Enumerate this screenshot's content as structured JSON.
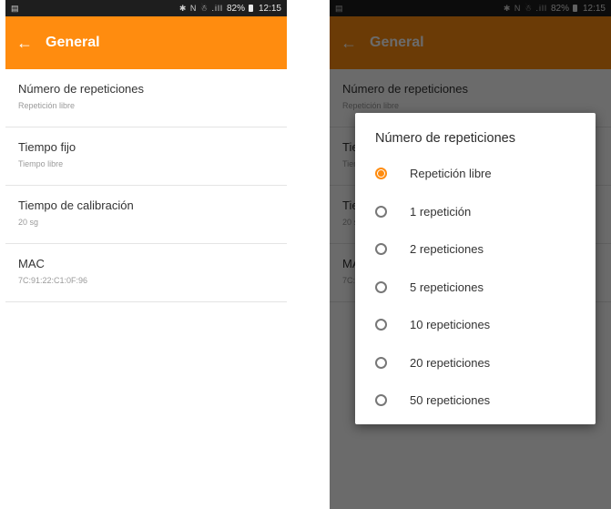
{
  "status_bar": {
    "icons": "✱ N ☃ .ill",
    "battery": "82%",
    "time": "12:15"
  },
  "toolbar": {
    "title": "General"
  },
  "settings": [
    {
      "title": "Número de repeticiones",
      "subtitle": "Repetición libre"
    },
    {
      "title": "Tiempo fijo",
      "subtitle": "Tiempo libre"
    },
    {
      "title": "Tiempo de calibración",
      "subtitle": "20 sg"
    },
    {
      "title": "MAC",
      "subtitle": "7C:91:22:C1:0F:96"
    }
  ],
  "dialog": {
    "title": "Número de repeticiones",
    "selected": "Repetición libre",
    "options": [
      "Repetición libre",
      "1 repetición",
      "2 repeticiones",
      "5 repeticiones",
      "10 repeticiones",
      "20 repeticiones",
      "50 repeticiones"
    ]
  },
  "colors": {
    "accent": "#ff8c0f",
    "status_bar": "#1e1e1e",
    "divider": "#e4e4e4"
  }
}
